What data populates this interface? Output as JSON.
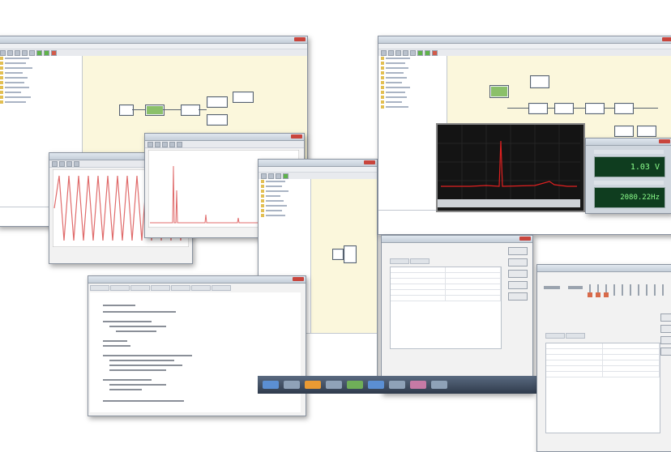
{
  "windows": {
    "w1": {
      "title": "",
      "kind": "flowgraph"
    },
    "w2": {
      "title": "",
      "kind": "waveform"
    },
    "w3": {
      "title": "",
      "kind": "spectrum"
    },
    "w4": {
      "title": "",
      "kind": "flowgraph-small"
    },
    "w5": {
      "title": "",
      "kind": "code-editor"
    },
    "w6": {
      "title": "",
      "kind": "flowgraph-with-scope"
    },
    "w7": {
      "title": "",
      "kind": "properties"
    },
    "w8": {
      "title": "",
      "kind": "properties-with-sliders"
    }
  },
  "instruments": {
    "voltage_display": {
      "value": "1.03  V"
    },
    "frequency_display": {
      "value": "2080.22Hz"
    }
  },
  "colors": {
    "flow_canvas": "#fbf7dc",
    "waveform_line": "#e06b6b",
    "spectrum_line": "#e02020",
    "lcd_text": "#8cff8c",
    "lcd_background": "#0f3d1f"
  },
  "icons": [
    "folder-icon",
    "block-icon",
    "wire-icon",
    "close-icon",
    "toolbar-button-icon"
  ]
}
